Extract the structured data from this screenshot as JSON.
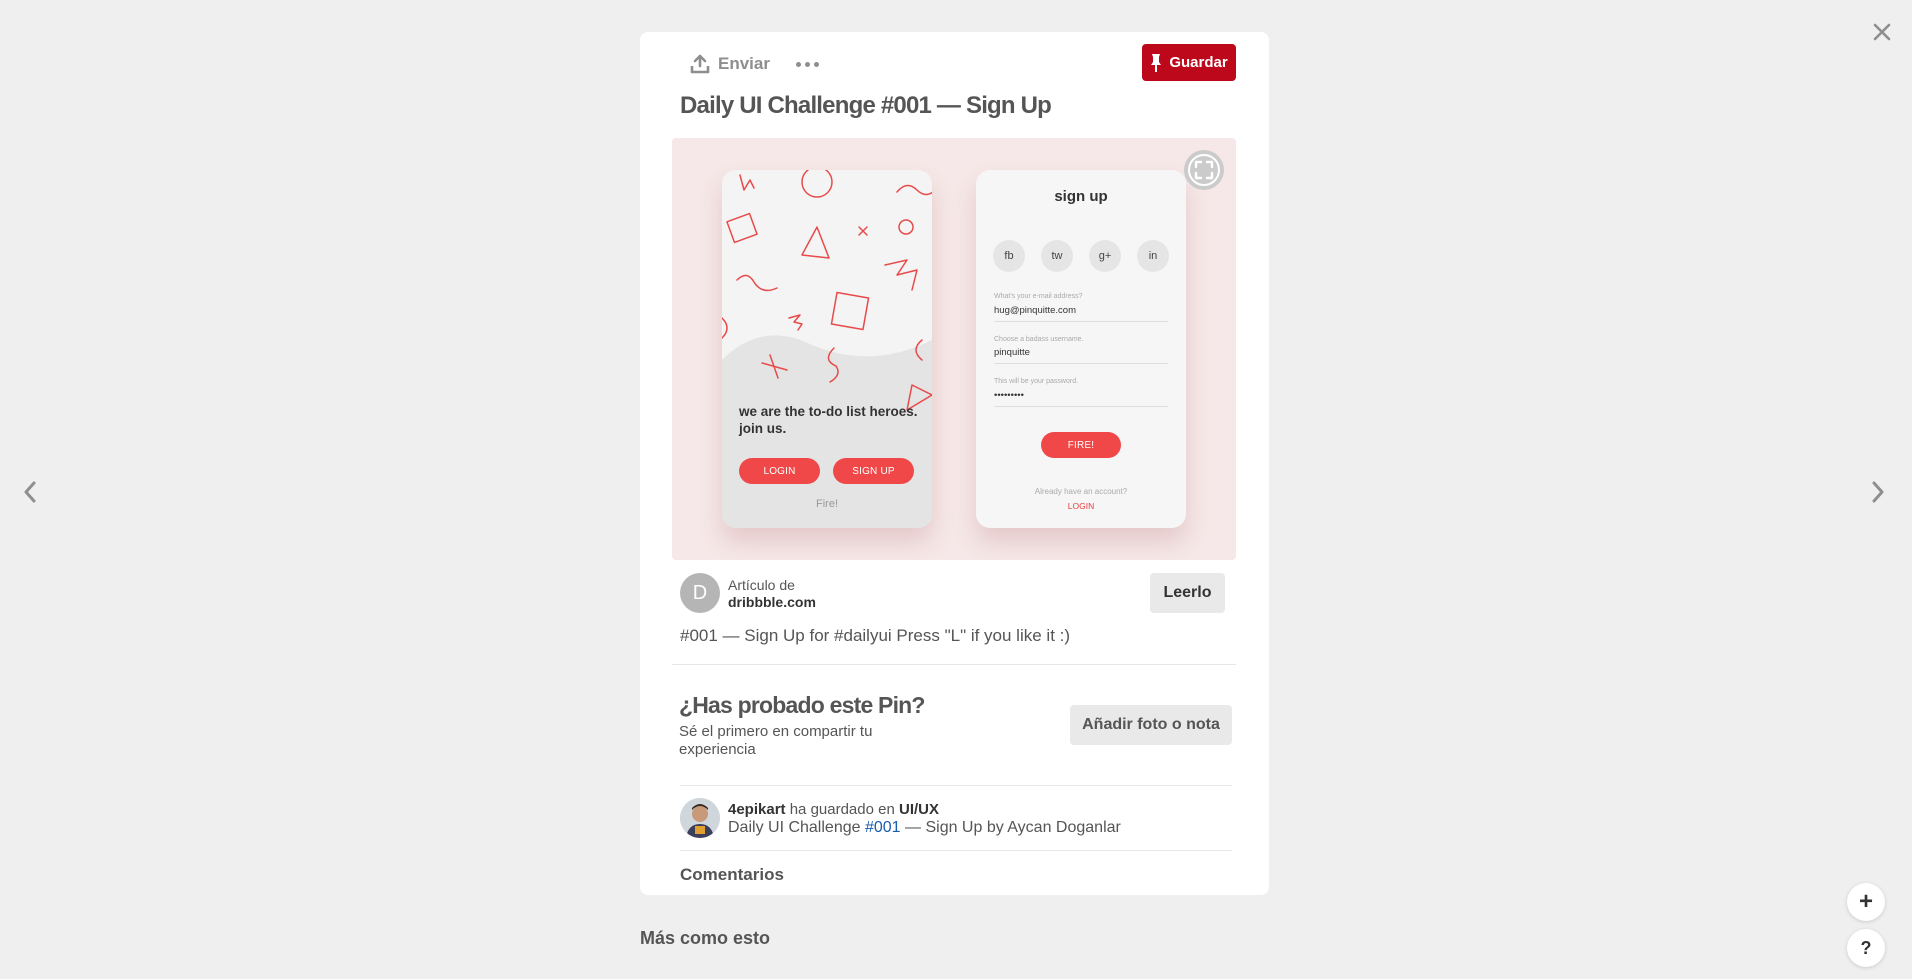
{
  "toolbar": {
    "send_label": "Enviar",
    "save_label": "Guardar"
  },
  "pin": {
    "title": "Daily UI Challenge #001 — Sign Up",
    "description": "#001 — Sign Up for #dailyui Press \"L\" if you like it :)"
  },
  "image": {
    "left_phone": {
      "tagline": "we are the to-do list heroes. join us.",
      "login_label": "LOGIN",
      "signup_label": "SIGN UP",
      "fire_label": "Fire!"
    },
    "right_phone": {
      "title": "sign up",
      "social": [
        "fb",
        "tw",
        "g+",
        "in"
      ],
      "fields": [
        {
          "label": "What's your e-mail address?",
          "value": "hug@pinquitte.com"
        },
        {
          "label": "Choose a badass username.",
          "value": "pinquitte"
        },
        {
          "label": "This will be your password.",
          "value": "•••••••••"
        }
      ],
      "fire_label": "FIRE!",
      "already_label": "Already have an account?",
      "login_label": "LOGIN"
    }
  },
  "source": {
    "avatar_letter": "D",
    "label": "Artículo de",
    "domain": "dribbble.com",
    "read_label": "Leerlo"
  },
  "tried": {
    "title": "¿Has probado este Pin?",
    "subtitle": "Sé el primero en compartir tu experiencia",
    "button_label": "Añadir foto o nota"
  },
  "saved": {
    "user": "4epikart",
    "action": "ha guardado en",
    "board": "UI/UX",
    "line2_pre": "Daily UI Challenge",
    "hashtag": "#001",
    "line2_post": "— Sign Up by Aycan Doganlar"
  },
  "comments_label": "Comentarios",
  "more_like_label": "Más como esto",
  "fab": {
    "plus": "+",
    "help": "?"
  },
  "colors": {
    "save_red": "#bd081c",
    "pill_red": "#f04848",
    "image_bg": "#f6e8e8",
    "link_blue": "#1a5db0"
  },
  "icons": [
    "close-icon",
    "chevron-left-icon",
    "chevron-right-icon",
    "upload-icon",
    "more-icon",
    "pin-icon",
    "expand-icon"
  ]
}
